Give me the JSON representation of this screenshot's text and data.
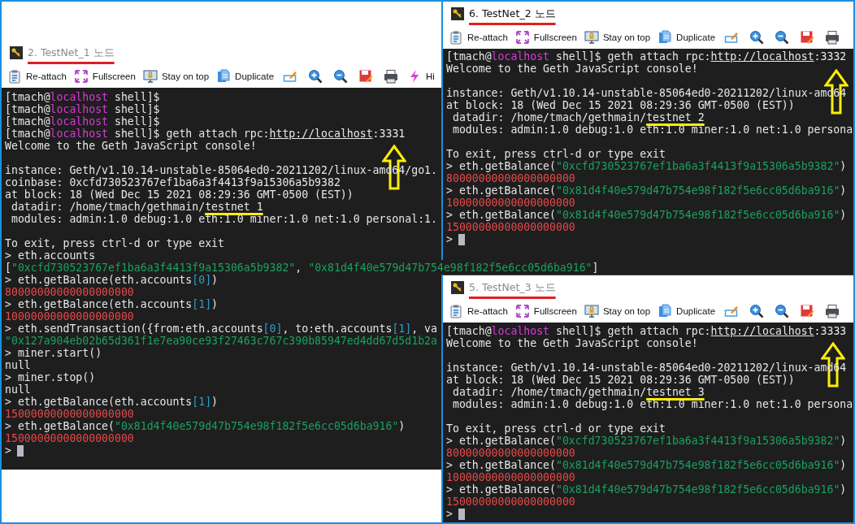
{
  "windows": [
    {
      "title": "2. TestNet_1 노드",
      "active": false,
      "toolbar": [
        {
          "kind": "clipboard",
          "label": "Re-attach"
        },
        {
          "kind": "fullscreen",
          "label": "Fullscreen"
        },
        {
          "kind": "monitor",
          "label": "Stay on top"
        },
        {
          "kind": "document",
          "label": "Duplicate"
        },
        {
          "kind": "pencil"
        },
        {
          "kind": "zoom-in"
        },
        {
          "kind": "zoom-out"
        },
        {
          "kind": "floppy"
        },
        {
          "kind": "printer"
        },
        {
          "kind": "lightning",
          "label": "Hi"
        }
      ],
      "lines": [
        {
          "kind": "text",
          "segments": [
            {
              "kind": "plain",
              "text": "[tmach@"
            },
            {
              "kind": "host",
              "text": "localhost"
            },
            {
              "kind": "plain",
              "text": " shell]$"
            }
          ]
        },
        {
          "kind": "text",
          "segments": [
            {
              "kind": "plain",
              "text": "[tmach@"
            },
            {
              "kind": "host",
              "text": "localhost"
            },
            {
              "kind": "plain",
              "text": " shell]$"
            }
          ]
        },
        {
          "kind": "text",
          "segments": [
            {
              "kind": "plain",
              "text": "[tmach@"
            },
            {
              "kind": "host",
              "text": "localhost"
            },
            {
              "kind": "plain",
              "text": " shell]$"
            }
          ]
        },
        {
          "kind": "text",
          "segments": [
            {
              "kind": "plain",
              "text": "[tmach@"
            },
            {
              "kind": "host",
              "text": "localhost"
            },
            {
              "kind": "plain",
              "text": " shell]$ geth attach rpc:"
            },
            {
              "kind": "url",
              "text": "http://localhost"
            },
            {
              "kind": "plain",
              "text": ":3331"
            }
          ]
        },
        {
          "kind": "text",
          "segments": [
            {
              "kind": "plain",
              "text": "Welcome to the Geth JavaScript console!"
            }
          ]
        },
        {
          "kind": "blank"
        },
        {
          "kind": "text",
          "segments": [
            {
              "kind": "plain",
              "text": "instance: Geth/v1.10.14-unstable-85064ed0-20211202/linux-amd64/go1."
            }
          ]
        },
        {
          "kind": "text",
          "segments": [
            {
              "kind": "plain",
              "text": "coinbase: 0xcfd730523767ef1ba6a3f4413f9a15306a5b9382"
            }
          ]
        },
        {
          "kind": "text",
          "segments": [
            {
              "kind": "plain",
              "text": "at block: 18 (Wed Dec 15 2021 08:29:36 GMT-0500 (EST))"
            }
          ]
        },
        {
          "kind": "text",
          "segments": [
            {
              "kind": "plain",
              "text": " datadir: /home/tmach/gethmain/"
            },
            {
              "kind": "marked",
              "text": "testnet_1"
            }
          ]
        },
        {
          "kind": "text",
          "segments": [
            {
              "kind": "plain",
              "text": " modules: admin:1.0 debug:1.0 eth:1.0 miner:1.0 net:1.0 personal:1."
            }
          ]
        },
        {
          "kind": "blank"
        },
        {
          "kind": "text",
          "segments": [
            {
              "kind": "plain",
              "text": "To exit, press ctrl-d or type exit"
            }
          ]
        },
        {
          "kind": "text",
          "segments": [
            {
              "kind": "plain",
              "text": "> eth.accounts"
            }
          ]
        },
        {
          "kind": "text",
          "segments": [
            {
              "kind": "plain",
              "text": "["
            },
            {
              "kind": "string",
              "text": "\"0xcfd730523767ef1ba6a3f4413f9a15306a5b9382\""
            },
            {
              "kind": "plain",
              "text": ", "
            },
            {
              "kind": "string",
              "text": "\"0x81d4f40e579d47b754e98f182f5e6cc05d6ba916\""
            },
            {
              "kind": "plain",
              "text": "]"
            }
          ]
        },
        {
          "kind": "text",
          "segments": [
            {
              "kind": "plain",
              "text": "> eth.getBalance(eth.accounts"
            },
            {
              "kind": "index",
              "text": "[0]"
            },
            {
              "kind": "plain",
              "text": ")"
            }
          ]
        },
        {
          "kind": "text",
          "segments": [
            {
              "kind": "number",
              "text": "80000000000000000000"
            }
          ]
        },
        {
          "kind": "text",
          "segments": [
            {
              "kind": "plain",
              "text": "> eth.getBalance(eth.accounts"
            },
            {
              "kind": "index",
              "text": "[1]"
            },
            {
              "kind": "plain",
              "text": ")"
            }
          ]
        },
        {
          "kind": "text",
          "segments": [
            {
              "kind": "number",
              "text": "10000000000000000000"
            }
          ]
        },
        {
          "kind": "text",
          "segments": [
            {
              "kind": "plain",
              "text": "> eth.sendTransaction({from:eth.accounts"
            },
            {
              "kind": "index",
              "text": "[0]"
            },
            {
              "kind": "plain",
              "text": ", to:eth.accounts"
            },
            {
              "kind": "index",
              "text": "[1]"
            },
            {
              "kind": "plain",
              "text": ", va"
            }
          ]
        },
        {
          "kind": "text",
          "segments": [
            {
              "kind": "string",
              "text": "\"0x127a904eb02b65d361f1e7ea90ce93f27463c767c390b85947ed4dd67d5d1b2a"
            }
          ]
        },
        {
          "kind": "text",
          "segments": [
            {
              "kind": "plain",
              "text": "> miner.start()"
            }
          ]
        },
        {
          "kind": "text",
          "segments": [
            {
              "kind": "plain",
              "text": "null"
            }
          ]
        },
        {
          "kind": "text",
          "segments": [
            {
              "kind": "plain",
              "text": "> miner.stop()"
            }
          ]
        },
        {
          "kind": "text",
          "segments": [
            {
              "kind": "plain",
              "text": "null"
            }
          ]
        },
        {
          "kind": "text",
          "segments": [
            {
              "kind": "plain",
              "text": "> eth.getBalance(eth.accounts"
            },
            {
              "kind": "index",
              "text": "[1]"
            },
            {
              "kind": "plain",
              "text": ")"
            }
          ]
        },
        {
          "kind": "text",
          "segments": [
            {
              "kind": "number",
              "text": "15000000000000000000"
            }
          ]
        },
        {
          "kind": "text",
          "segments": [
            {
              "kind": "plain",
              "text": "> eth.getBalance("
            },
            {
              "kind": "string",
              "text": "\"0x81d4f40e579d47b754e98f182f5e6cc05d6ba916\""
            },
            {
              "kind": "plain",
              "text": ")"
            }
          ]
        },
        {
          "kind": "text",
          "segments": [
            {
              "kind": "number",
              "text": "15000000000000000000"
            }
          ]
        },
        {
          "kind": "cursor",
          "text": ">"
        }
      ]
    },
    {
      "title": "6. TestNet_2 노드",
      "active": true,
      "toolbar": [
        {
          "kind": "clipboard",
          "label": "Re-attach"
        },
        {
          "kind": "fullscreen",
          "label": "Fullscreen"
        },
        {
          "kind": "monitor",
          "label": "Stay on top"
        },
        {
          "kind": "document",
          "label": "Duplicate"
        },
        {
          "kind": "pencil"
        },
        {
          "kind": "zoom-in"
        },
        {
          "kind": "zoom-out"
        },
        {
          "kind": "floppy"
        },
        {
          "kind": "printer"
        }
      ],
      "lines": [
        {
          "kind": "text",
          "segments": [
            {
              "kind": "plain",
              "text": "[tmach@"
            },
            {
              "kind": "host",
              "text": "localhost"
            },
            {
              "kind": "plain",
              "text": " shell]$ geth attach rpc:"
            },
            {
              "kind": "url",
              "text": "http://localhost"
            },
            {
              "kind": "plain",
              "text": ":3332"
            }
          ]
        },
        {
          "kind": "text",
          "segments": [
            {
              "kind": "plain",
              "text": "Welcome to the Geth JavaScript console!"
            }
          ]
        },
        {
          "kind": "blank"
        },
        {
          "kind": "text",
          "segments": [
            {
              "kind": "plain",
              "text": "instance: Geth/v1.10.14-unstable-85064ed0-20211202/linux-amd64"
            }
          ]
        },
        {
          "kind": "text",
          "segments": [
            {
              "kind": "plain",
              "text": "at block: 18 (Wed Dec 15 2021 08:29:36 GMT-0500 (EST))"
            }
          ]
        },
        {
          "kind": "text",
          "segments": [
            {
              "kind": "plain",
              "text": " datadir: /home/tmach/gethmain/"
            },
            {
              "kind": "marked",
              "text": "testnet_2"
            }
          ]
        },
        {
          "kind": "text",
          "segments": [
            {
              "kind": "plain",
              "text": " modules: admin:1.0 debug:1.0 eth:1.0 miner:1.0 net:1.0 persona"
            }
          ]
        },
        {
          "kind": "blank"
        },
        {
          "kind": "text",
          "segments": [
            {
              "kind": "plain",
              "text": "To exit, press ctrl-d or type exit"
            }
          ]
        },
        {
          "kind": "text",
          "segments": [
            {
              "kind": "plain",
              "text": "> eth.getBalance("
            },
            {
              "kind": "string",
              "text": "\"0xcfd730523767ef1ba6a3f4413f9a15306a5b9382\""
            },
            {
              "kind": "plain",
              "text": ")"
            }
          ]
        },
        {
          "kind": "text",
          "segments": [
            {
              "kind": "number",
              "text": "80000000000000000000"
            }
          ]
        },
        {
          "kind": "text",
          "segments": [
            {
              "kind": "plain",
              "text": "> eth.getBalance("
            },
            {
              "kind": "string",
              "text": "\"0x81d4f40e579d47b754e98f182f5e6cc05d6ba916\""
            },
            {
              "kind": "plain",
              "text": ")"
            }
          ]
        },
        {
          "kind": "text",
          "segments": [
            {
              "kind": "number",
              "text": "10000000000000000000"
            }
          ]
        },
        {
          "kind": "text",
          "segments": [
            {
              "kind": "plain",
              "text": "> eth.getBalance("
            },
            {
              "kind": "string",
              "text": "\"0x81d4f40e579d47b754e98f182f5e6cc05d6ba916\""
            },
            {
              "kind": "plain",
              "text": ")"
            }
          ]
        },
        {
          "kind": "text",
          "segments": [
            {
              "kind": "number",
              "text": "15000000000000000000"
            }
          ]
        },
        {
          "kind": "cursor",
          "text": ">"
        }
      ]
    },
    {
      "title": "5. TestNet_3 노드",
      "active": false,
      "toolbar": [
        {
          "kind": "clipboard",
          "label": "Re-attach"
        },
        {
          "kind": "fullscreen",
          "label": "Fullscreen"
        },
        {
          "kind": "monitor",
          "label": "Stay on top"
        },
        {
          "kind": "document",
          "label": "Duplicate"
        },
        {
          "kind": "pencil"
        },
        {
          "kind": "zoom-in"
        },
        {
          "kind": "zoom-out"
        },
        {
          "kind": "floppy"
        },
        {
          "kind": "printer"
        }
      ],
      "lines": [
        {
          "kind": "text",
          "segments": [
            {
              "kind": "plain",
              "text": "[tmach@"
            },
            {
              "kind": "host",
              "text": "localhost"
            },
            {
              "kind": "plain",
              "text": " shell]$ geth attach rpc:"
            },
            {
              "kind": "url",
              "text": "http://localhost"
            },
            {
              "kind": "plain",
              "text": ":3333"
            }
          ]
        },
        {
          "kind": "text",
          "segments": [
            {
              "kind": "plain",
              "text": "Welcome to the Geth JavaScript console!"
            }
          ]
        },
        {
          "kind": "blank"
        },
        {
          "kind": "text",
          "segments": [
            {
              "kind": "plain",
              "text": "instance: Geth/v1.10.14-unstable-85064ed0-20211202/linux-amd64"
            }
          ]
        },
        {
          "kind": "text",
          "segments": [
            {
              "kind": "plain",
              "text": "at block: 18 (Wed Dec 15 2021 08:29:36 GMT-0500 (EST))"
            }
          ]
        },
        {
          "kind": "text",
          "segments": [
            {
              "kind": "plain",
              "text": " datadir: /home/tmach/gethmain/"
            },
            {
              "kind": "marked",
              "text": "testnet_3"
            }
          ]
        },
        {
          "kind": "text",
          "segments": [
            {
              "kind": "plain",
              "text": " modules: admin:1.0 debug:1.0 eth:1.0 miner:1.0 net:1.0 persona"
            }
          ]
        },
        {
          "kind": "blank"
        },
        {
          "kind": "text",
          "segments": [
            {
              "kind": "plain",
              "text": "To exit, press ctrl-d or type exit"
            }
          ]
        },
        {
          "kind": "text",
          "segments": [
            {
              "kind": "plain",
              "text": "> eth.getBalance("
            },
            {
              "kind": "string",
              "text": "\"0xcfd730523767ef1ba6a3f4413f9a15306a5b9382\""
            },
            {
              "kind": "plain",
              "text": ")"
            }
          ]
        },
        {
          "kind": "text",
          "segments": [
            {
              "kind": "number",
              "text": "80000000000000000000"
            }
          ]
        },
        {
          "kind": "text",
          "segments": [
            {
              "kind": "plain",
              "text": "> eth.getBalance("
            },
            {
              "kind": "string",
              "text": "\"0x81d4f40e579d47b754e98f182f5e6cc05d6ba916\""
            },
            {
              "kind": "plain",
              "text": ")"
            }
          ]
        },
        {
          "kind": "text",
          "segments": [
            {
              "kind": "number",
              "text": "10000000000000000000"
            }
          ]
        },
        {
          "kind": "text",
          "segments": [
            {
              "kind": "plain",
              "text": "> eth.getBalance("
            },
            {
              "kind": "string",
              "text": "\"0x81d4f40e579d47b754e98f182f5e6cc05d6ba916\""
            },
            {
              "kind": "plain",
              "text": ")"
            }
          ]
        },
        {
          "kind": "text",
          "segments": [
            {
              "kind": "number",
              "text": "15000000000000000000"
            }
          ]
        },
        {
          "kind": "cursor",
          "text": ">"
        }
      ]
    }
  ]
}
